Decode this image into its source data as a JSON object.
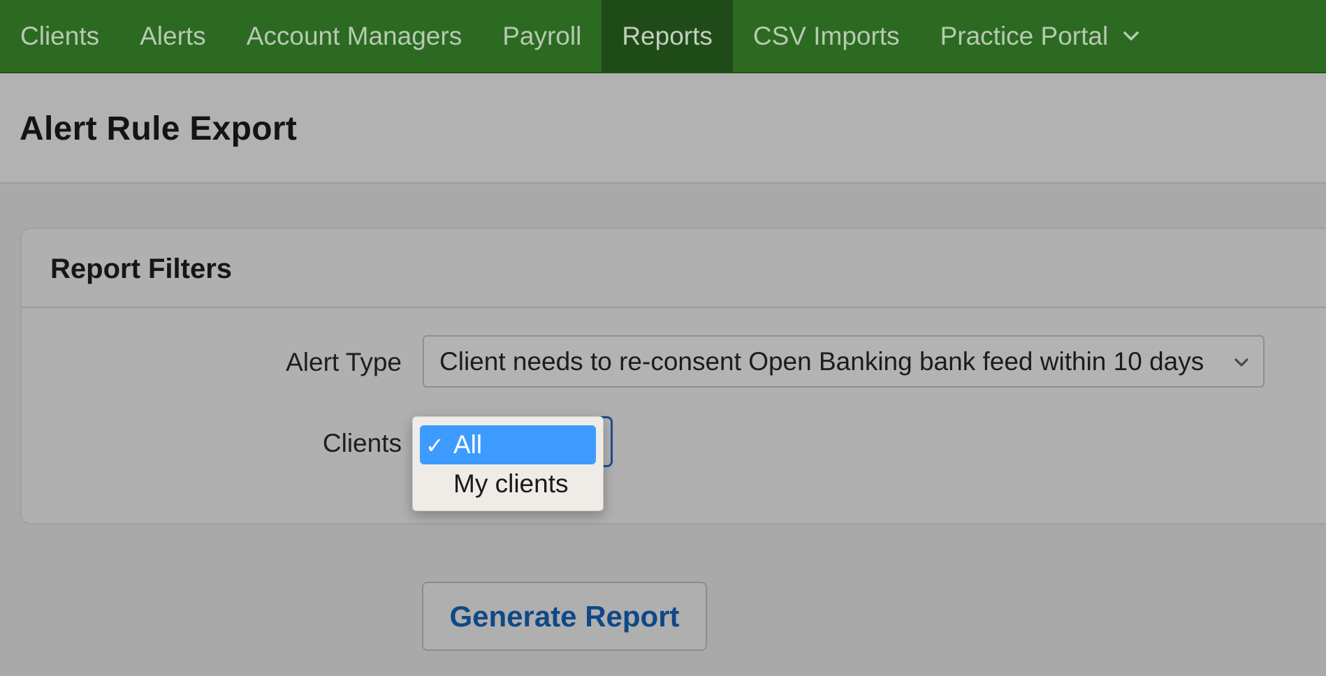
{
  "nav": {
    "items": [
      {
        "label": "Clients"
      },
      {
        "label": "Alerts"
      },
      {
        "label": "Account Managers"
      },
      {
        "label": "Payroll"
      },
      {
        "label": "Reports",
        "active": true
      },
      {
        "label": "CSV Imports"
      },
      {
        "label": "Practice Portal",
        "icon": "chevron-down-icon"
      }
    ]
  },
  "page": {
    "title": "Alert Rule Export"
  },
  "filters": {
    "title": "Report Filters",
    "alert_type": {
      "label": "Alert Type",
      "value": "Client needs to re-consent Open Banking bank feed within 10 days",
      "icon": "chevron-down-icon"
    },
    "clients": {
      "label": "Clients",
      "options": [
        {
          "label": "All",
          "selected": true,
          "check": "✓"
        },
        {
          "label": "My clients",
          "selected": false
        }
      ]
    }
  },
  "actions": {
    "generate_label": "Generate Report"
  },
  "colors": {
    "nav_bg": "#2c6a22",
    "nav_active_bg": "#1f4b18",
    "selected_option": "#3d9bff",
    "button_text": "#0f4887"
  }
}
